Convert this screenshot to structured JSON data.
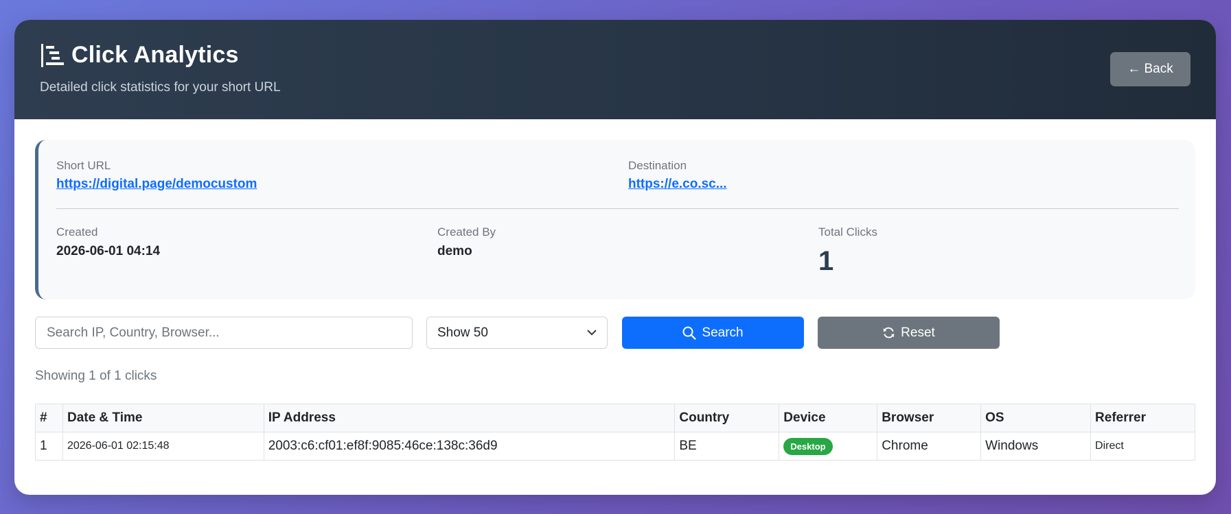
{
  "header": {
    "title": "Click Analytics",
    "subtitle": "Detailed click statistics for your short URL",
    "back_label": "← Back"
  },
  "info": {
    "short_url_label": "Short URL",
    "short_url": "https://digital.page/democustom",
    "destination_label": "Destination",
    "destination": "https://e.co.sc...",
    "created_label": "Created",
    "created": "2026-06-01 04:14",
    "created_by_label": "Created By",
    "created_by": "demo",
    "total_clicks_label": "Total Clicks",
    "total_clicks": "1"
  },
  "filters": {
    "search_placeholder": "Search IP, Country, Browser...",
    "show_value": "Show 50",
    "search_label": "Search",
    "reset_label": "Reset"
  },
  "showing_text": "Showing 1 of 1 clicks",
  "table": {
    "headers": [
      "#",
      "Date & Time",
      "IP Address",
      "Country",
      "Device",
      "Browser",
      "OS",
      "Referrer"
    ],
    "rows": [
      {
        "num": "1",
        "datetime": "2026-06-01 02:15:48",
        "ip": "2003:c6:cf01:ef8f:9085:46ce:138c:36d9",
        "country": "BE",
        "device": "Desktop",
        "browser": "Chrome",
        "os": "Windows",
        "referrer": "Direct"
      }
    ]
  },
  "colors": {
    "primary": "#0d6efd",
    "secondary": "#6c757d",
    "success_badge": "#28a745",
    "header_bg": "#263445"
  }
}
